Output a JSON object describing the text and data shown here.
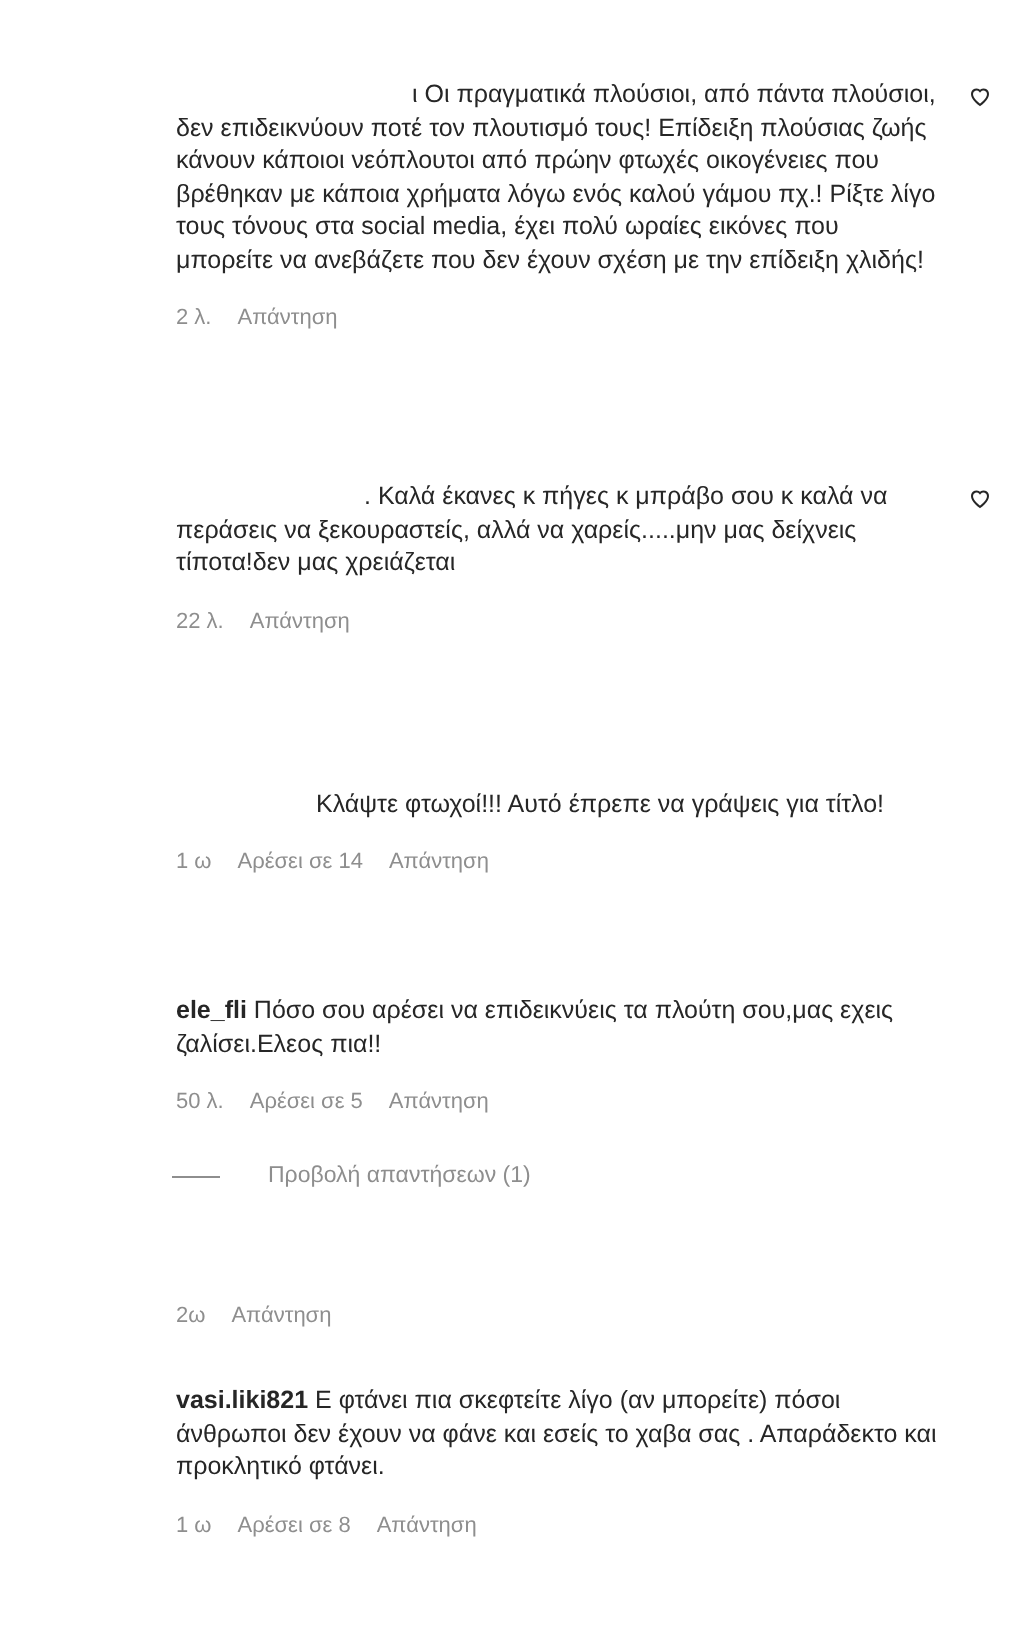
{
  "comments": [
    {
      "kind": "comment",
      "text": "ι Οι πραγματικά πλούσιοι, από πάντα πλούσιοι, δεν επιδεικνύουν ποτέ τον πλουτισμό τους! Επίδειξη πλούσιας ζωής κάνουν κάποιοι νεόπλουτοι από πρώην φτωχές οικογένειες που βρέθηκαν με κάποια χρήματα λόγω ενός καλού γάμου πχ.! Ρίξτε λίγο τους τόνους στα social media, έχει πολύ ωραίες εικόνες που μπορείτε να ανεβάζετε που δεν έχουν σχέση με την επίδειξη χλιδής!",
      "time": "2 λ.",
      "reply": "Απάντηση",
      "liked": false
    },
    {
      "kind": "comment",
      "text": ". Καλά έκανες κ πήγες κ μπράβο σου κ καλά να περάσεις να ξεκουραστείς, αλλά να χαρείς.....μην μας δείχνεις τίποτα!δεν μας χρειάζεται",
      "time": "22 λ.",
      "reply": "Απάντηση",
      "liked": false
    },
    {
      "kind": "comment",
      "text": "Κλάψτε φτωχοί!!! Αυτό έπρεπε να γράψεις για τίτλο!",
      "time": "1 ω",
      "likes": "Αρέσει σε 14",
      "reply": "Απάντηση"
    },
    {
      "kind": "comment",
      "username": "ele_fli",
      "text": "Πόσο σου αρέσει να επιδεικνύεις τα πλούτη σου,μας εχεις ζαλίσει.Ελεος πια!!",
      "time": "50 λ.",
      "likes": "Αρέσει σε 5",
      "reply": "Απάντηση"
    },
    {
      "kind": "replies",
      "text": "Προβολή απαντήσεων (1)"
    },
    {
      "kind": "meta",
      "time": "2ω",
      "reply": "Απάντηση"
    },
    {
      "kind": "comment",
      "username": "vasi.liki821",
      "text": "Ε φτάνει πια σκεφτείτε λίγο (αν μπορείτε) πόσοι άνθρωποι δεν έχουν να φάνε και εσείς το χαβα σας . Απαράδεκτο και προκλητικό φτάνει.",
      "time": "1 ω",
      "likes": "Αρέσει σε 8",
      "reply": "Απάντηση"
    }
  ]
}
